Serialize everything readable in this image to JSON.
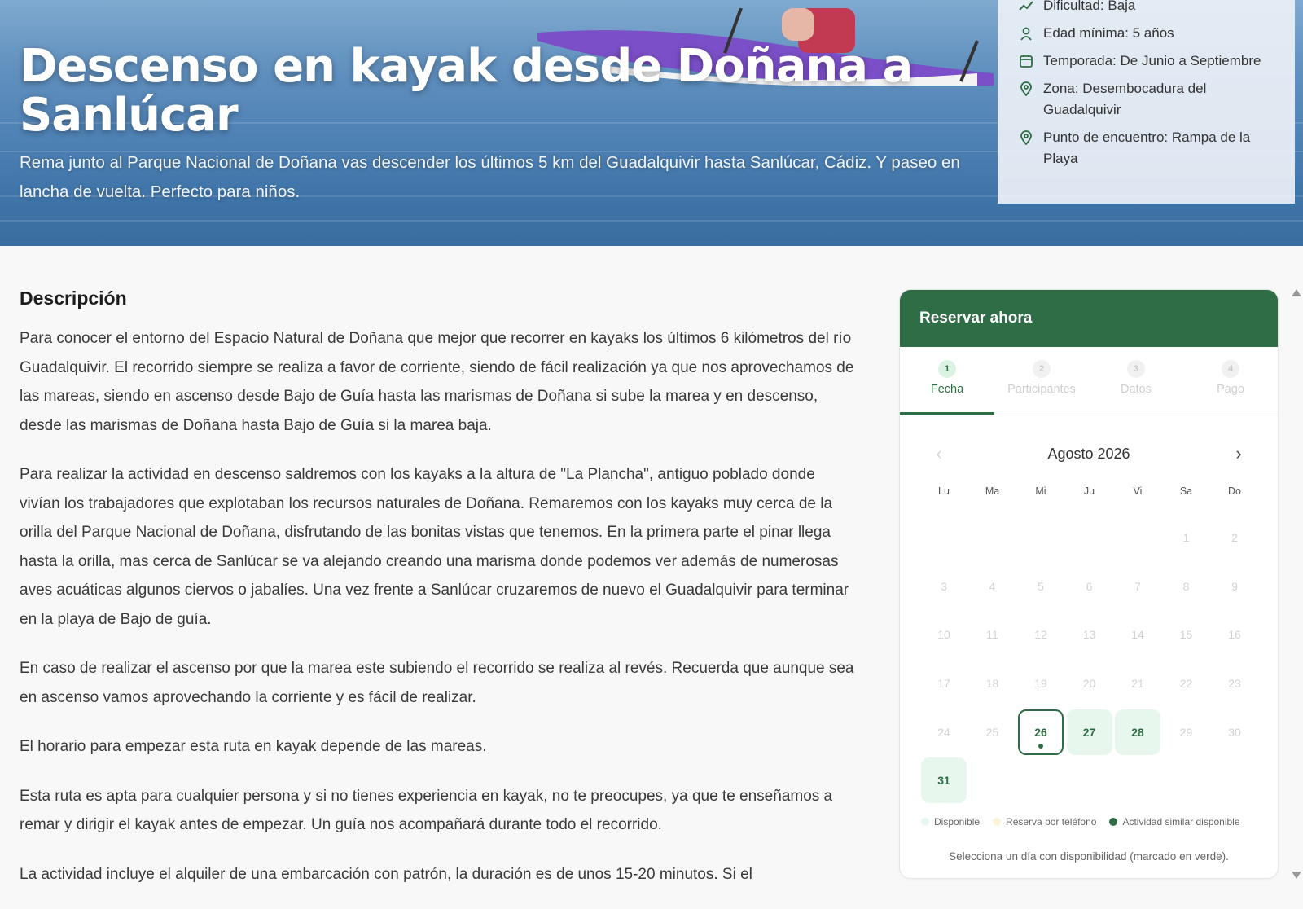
{
  "hero": {
    "title": "Descenso en kayak desde Doñana a Sanlúcar",
    "subtitle": "Rema junto al Parque Nacional de Doñana vas descender los últimos 5 km del Guadalquivir hasta Sanlúcar, Cádiz. Y paseo en lancha de vuelta. Perfecto para niños."
  },
  "info": {
    "difficulty": "Dificultad: Baja",
    "min_age": "Edad mínima: 5 años",
    "season_label": "Temporada:",
    "season_value": "De Junio a Septiembre",
    "zone_label": "Zona:",
    "zone_value": "Desembocadura del Guadalquivir",
    "meeting_label": "Punto de encuentro:",
    "meeting_value": "Rampa de la Playa"
  },
  "description": {
    "heading": "Descripción",
    "paragraphs": [
      "Para conocer el entorno del Espacio Natural de Doñana que mejor que recorrer en kayaks los últimos 6 kilómetros del río Guadalquivir. El recorrido siempre se realiza a favor de corriente, siendo de fácil realización ya que nos aprovechamos de las mareas, siendo en ascenso desde Bajo de Guía hasta las marismas de Doñana si sube la marea y en descenso, desde las marismas de Doñana hasta Bajo de Guía si la marea baja.",
      "Para realizar la actividad en descenso saldremos con los kayaks a la altura de \"La Plancha\", antiguo poblado donde vivían los trabajadores que explotaban los recursos naturales de Doñana. Remaremos con los kayaks muy cerca de la orilla del Parque Nacional de Doñana, disfrutando de las bonitas vistas que tenemos. En la primera parte el pinar llega hasta la orilla, mas cerca de Sanlúcar se va alejando creando una marisma donde podemos ver además de numerosas aves acuáticas algunos ciervos o jabalíes. Una vez frente a Sanlúcar cruzaremos de nuevo el Guadalquivir para terminar en la playa de Bajo de guía.",
      "En caso de realizar el ascenso por que la marea este subiendo el recorrido se realiza al revés. Recuerda que aunque sea en ascenso vamos aprovechando la corriente y es fácil de realizar.",
      "El horario para empezar esta ruta en kayak depende de las mareas.",
      "Esta ruta es apta para cualquier persona y si no tienes experiencia en kayak, no te preocupes, ya que te enseñamos a remar y dirigir el kayak antes de empezar. Un guía nos acompañará durante todo el recorrido.",
      "La actividad incluye el alquiler de una embarcación con patrón, la duración es de unos 15-20 minutos. Si el"
    ]
  },
  "booking": {
    "title": "Reservar ahora",
    "steps": [
      {
        "num": "1",
        "label": "Fecha"
      },
      {
        "num": "2",
        "label": "Participantes"
      },
      {
        "num": "3",
        "label": "Datos"
      },
      {
        "num": "4",
        "label": "Pago"
      }
    ],
    "month": "Agosto 2026",
    "weekdays": [
      "Lu",
      "Ma",
      "Mi",
      "Ju",
      "Vi",
      "Sa",
      "Do"
    ],
    "legend": {
      "available": "Disponible",
      "phone": "Reserva por teléfono",
      "similar": "Actividad similar disponible"
    },
    "hint": "Selecciona un día con disponibilidad (marcado en verde).",
    "colors": {
      "brand": "#2e6d45",
      "available": "#e8f7ed",
      "phone": "#fdf3d6",
      "similar": "#2e6d45"
    }
  }
}
